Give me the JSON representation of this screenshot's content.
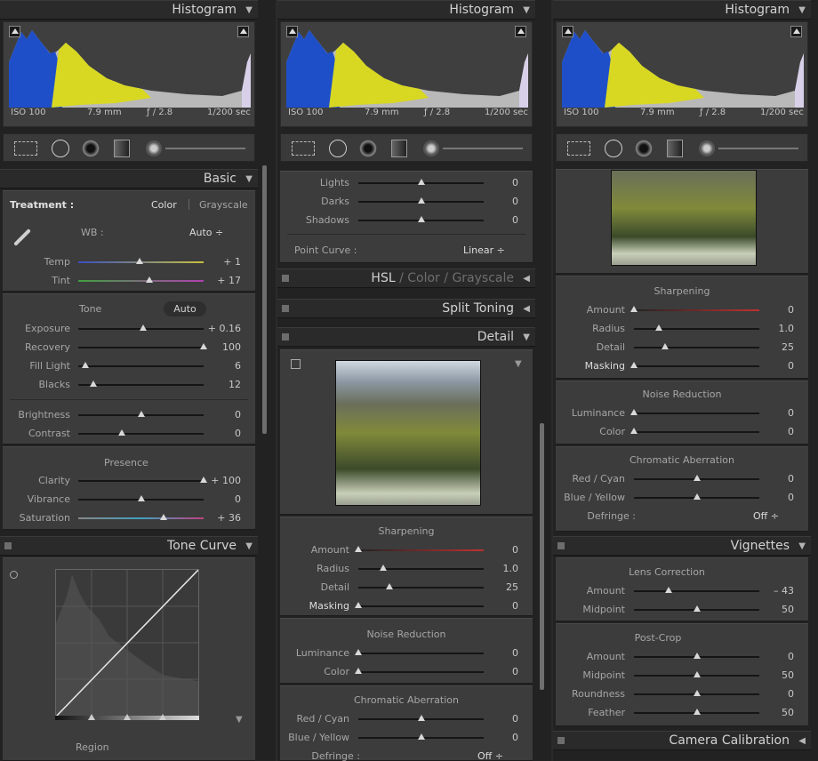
{
  "histogram": {
    "title": "Histogram",
    "iso": "ISO 100",
    "focal": "7.9 mm",
    "aperture": "ƒ / 2.8",
    "shutter": "1/200 sec"
  },
  "col1": {
    "basic": {
      "title": "Basic",
      "treatment_label": "Treatment :",
      "color": "Color",
      "grayscale": "Grayscale",
      "wb_label": "WB :",
      "wb_value": "Auto ÷",
      "temp": "Temp",
      "temp_val": "+ 1",
      "tint": "Tint",
      "tint_val": "+ 17",
      "tone": "Tone",
      "auto": "Auto",
      "exposure": "Exposure",
      "exposure_val": "+ 0.16",
      "recovery": "Recovery",
      "recovery_val": "100",
      "fill_light": "Fill Light",
      "fill_light_val": "6",
      "blacks": "Blacks",
      "blacks_val": "12",
      "brightness": "Brightness",
      "brightness_val": "0",
      "contrast": "Contrast",
      "contrast_val": "0",
      "presence": "Presence",
      "clarity": "Clarity",
      "clarity_val": "+ 100",
      "vibrance": "Vibrance",
      "vibrance_val": "0",
      "saturation": "Saturation",
      "saturation_val": "+ 36"
    },
    "tone_curve": {
      "title": "Tone Curve",
      "region": "Region"
    }
  },
  "col2": {
    "curve": {
      "lights": "Lights",
      "lights_val": "0",
      "darks": "Darks",
      "darks_val": "0",
      "shadows": "Shadows",
      "shadows_val": "0",
      "point_curve_label": "Point Curve :",
      "point_curve_val": "Linear ÷"
    },
    "hsl": {
      "hsl": "HSL",
      "sep1": "/",
      "color": "Color",
      "sep2": "/",
      "grayscale": "Grayscale"
    },
    "split_toning": "Split Toning",
    "detail": {
      "title": "Detail",
      "sharpening": "Sharpening",
      "amount": "Amount",
      "amount_val": "0",
      "radius": "Radius",
      "radius_val": "1.0",
      "detail": "Detail",
      "detail_val": "25",
      "masking": "Masking",
      "masking_val": "0",
      "noise_reduction": "Noise Reduction",
      "luminance": "Luminance",
      "luminance_val": "0",
      "color": "Color",
      "color_val": "0",
      "chromatic_aberration": "Chromatic Aberration",
      "red_cyan": "Red / Cyan",
      "red_cyan_val": "0",
      "blue_yellow": "Blue / Yellow",
      "blue_yellow_val": "0",
      "defringe": "Defringe :",
      "defringe_val": "Off ÷"
    }
  },
  "col3": {
    "detail": {
      "sharpening": "Sharpening",
      "amount": "Amount",
      "amount_val": "0",
      "radius": "Radius",
      "radius_val": "1.0",
      "detail": "Detail",
      "detail_val": "25",
      "masking": "Masking",
      "masking_val": "0",
      "noise_reduction": "Noise Reduction",
      "luminance": "Luminance",
      "luminance_val": "0",
      "color": "Color",
      "color_val": "0",
      "chromatic_aberration": "Chromatic Aberration",
      "red_cyan": "Red / Cyan",
      "red_cyan_val": "0",
      "blue_yellow": "Blue / Yellow",
      "blue_yellow_val": "0",
      "defringe": "Defringe :",
      "defringe_val": "Off ÷"
    },
    "vignettes": {
      "title": "Vignettes",
      "lens_correction": "Lens Correction",
      "amount": "Amount",
      "amount_val": "– 43",
      "midpoint": "Midpoint",
      "midpoint_val": "50",
      "post_crop": "Post-Crop",
      "pc_amount": "Amount",
      "pc_amount_val": "0",
      "pc_midpoint": "Midpoint",
      "pc_midpoint_val": "50",
      "roundness": "Roundness",
      "roundness_val": "0",
      "feather": "Feather",
      "feather_val": "50"
    },
    "camera_calibration": "Camera Calibration"
  },
  "sliders": {
    "temp": 0.49,
    "tint": 0.57,
    "exposure": 0.52,
    "recovery": 1.0,
    "fill_light": 0.06,
    "blacks": 0.12,
    "brightness": 0.5,
    "contrast": 0.35,
    "clarity": 1.0,
    "vibrance": 0.5,
    "saturation": 0.68,
    "lights": 0.5,
    "darks": 0.5,
    "shadows": 0.5,
    "sharp_amount": 0.0,
    "sharp_radius": 0.2,
    "sharp_detail": 0.25,
    "sharp_masking": 0.0,
    "nr_luminance": 0.0,
    "nr_color": 0.0,
    "ca_red_cyan": 0.5,
    "ca_blue_yellow": 0.5,
    "vig_amount": 0.28,
    "vig_midpoint": 0.5,
    "pc_amount": 0.5,
    "pc_midpoint": 0.5,
    "pc_roundness": 0.5,
    "pc_feather": 0.5
  },
  "colors": {
    "panel": "#3c3c3c",
    "header": "#2a2a2a",
    "background": "#222222"
  }
}
